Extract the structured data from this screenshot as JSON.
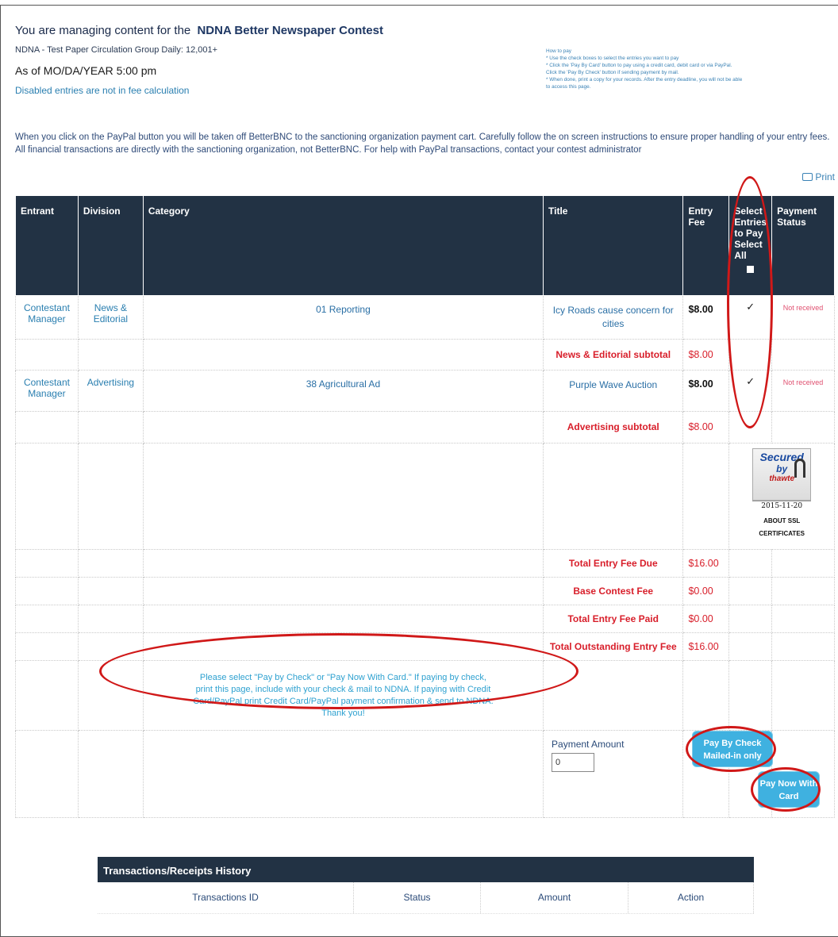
{
  "header": {
    "managing_text": "You are managing content for the",
    "contest_name": "NDNA Better Newspaper Contest",
    "paper_group": "NDNA - Test Paper Circulation Group Daily: 12,001+",
    "as_of": "As of MO/DA/YEAR 5:00 pm",
    "disabled_note": "Disabled entries are not in fee calculation"
  },
  "how_to_pay": {
    "title": "How to pay",
    "lines": [
      "* Use the check boxes to select the entries you want to pay",
      "* Click the 'Pay By Card' button to pay using a credit card, debit card or via PayPal.",
      "  Click the 'Pay By Check' button if sending payment by mail.",
      "* When done, print a copy for your records. After the entry deadline, you will not be able",
      "to access this page."
    ]
  },
  "paypal_note": "When you click on the PayPal button you will be taken off BetterBNC to the sanctioning organization payment cart. Carefully follow the on screen instructions to ensure proper handling of your entry fees. All financial transactions are directly with the sanctioning organization, not BetterBNC. For help with PayPal transactions, contact your contest administrator",
  "print_label": "Print",
  "table": {
    "headers": {
      "entrant": "Entrant",
      "division": "Division",
      "category": "Category",
      "title": "Title",
      "entry_fee": "Entry Fee",
      "select": "Select Entries to Pay Select All",
      "payment_status": "Payment Status"
    },
    "rows": [
      {
        "entrant": "Contestant Manager",
        "division": "News & Editorial",
        "category": "01 Reporting",
        "title": "Icy Roads cause concern for cities",
        "fee": "$8.00",
        "checked": "✓",
        "status": "Not received",
        "subtotal_label": "News & Editorial subtotal",
        "subtotal_fee": "$8.00"
      },
      {
        "entrant": "Contestant Manager",
        "division": "Advertising",
        "category": "38 Agricultural Ad",
        "title": "Purple Wave Auction",
        "fee": "$8.00",
        "checked": "✓",
        "status": "Not received",
        "subtotal_label": "Advertising subtotal",
        "subtotal_fee": "$8.00"
      }
    ],
    "ssl": {
      "secured": "Secured",
      "by": "by",
      "brand": "thawte",
      "date": "2015-11-20",
      "about": "ABOUT SSL CERTIFICATES"
    },
    "totals": [
      {
        "label": "Total Entry Fee Due",
        "amount": "$16.00"
      },
      {
        "label": "Base Contest Fee",
        "amount": "$0.00"
      },
      {
        "label": "Total Entry Fee Paid",
        "amount": "$0.00"
      },
      {
        "label": "Total Outstanding Entry Fee",
        "amount": "$16.00"
      }
    ],
    "notice": "Please select \"Pay by Check\" or \"Pay Now With Card.\" If paying by check, print this page, include with your check & mail to NDNA. If paying with Credit Card/PayPal print Credit Card/PayPal payment confirmation & send to NDNA. Thank you!"
  },
  "payment": {
    "amount_label": "Payment Amount",
    "amount_value": "0",
    "pay_by_check": "Pay By Check Mailed-in only",
    "pay_now_card": "Pay Now With Card"
  },
  "transactions": {
    "title": "Transactions/Receipts History",
    "columns": [
      "Transactions ID",
      "Status",
      "Amount",
      "Action"
    ]
  },
  "colors": {
    "header_bg": "#223244",
    "accent_red": "#d81e2a",
    "link_blue": "#2a7fb0",
    "button_blue": "#3fb1e0",
    "annotation_red": "#d01818"
  }
}
